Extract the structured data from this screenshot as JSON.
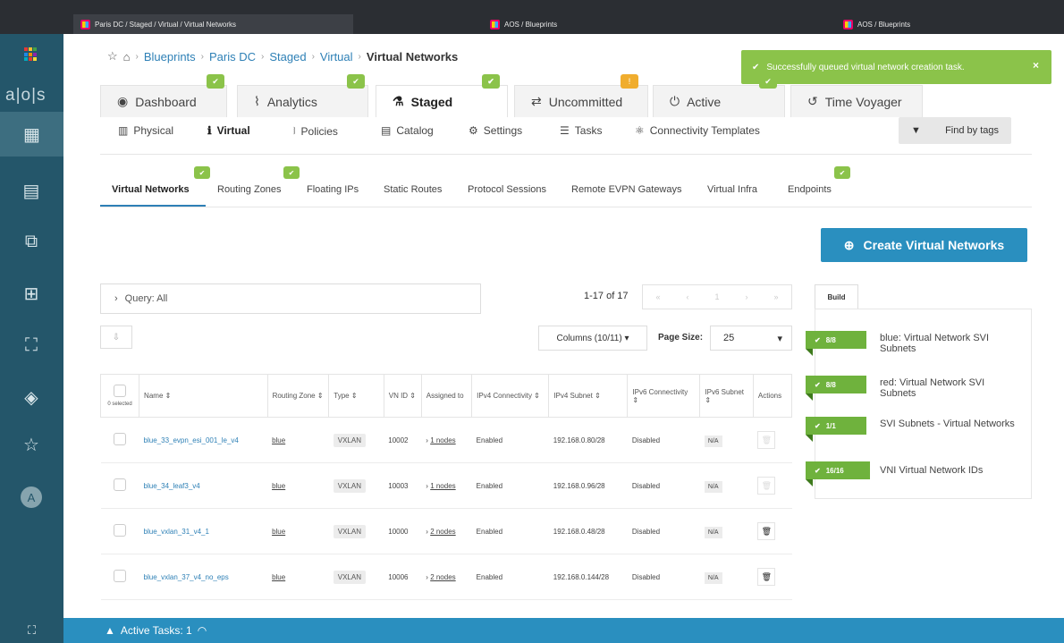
{
  "browser": {
    "tabs": [
      {
        "title": "Paris DC / Staged / Virtual / Virtual Networks"
      },
      {
        "title": "AOS / Blueprints"
      },
      {
        "title": "AOS / Blueprints"
      }
    ]
  },
  "rail": {
    "logo_text": "a|o|s",
    "logo_colors": [
      "#e53935",
      "#fbc02d",
      "#43a047",
      "#1e88e5",
      "#fb8c00",
      "#8e24aa",
      "#00acc1",
      "#e53935",
      "#fdd835"
    ],
    "icons": [
      "blueprints-icon",
      "devices-icon",
      "design-icon",
      "resources-icon",
      "external-systems-icon",
      "platform-icon",
      "favorites-icon"
    ],
    "avatar": "A"
  },
  "breadcrumb": {
    "items": [
      "Blueprints",
      "Paris DC",
      "Staged",
      "Virtual"
    ],
    "current": "Virtual Networks"
  },
  "toast": {
    "message": "Successfully queued virtual network creation task.",
    "close": "×",
    "color": "#8bc34a"
  },
  "main_tabs": [
    {
      "label": "Dashboard",
      "icon": "◉",
      "badge": "✔"
    },
    {
      "label": "Analytics",
      "icon": "⌇",
      "badge": "✔"
    },
    {
      "label": "Staged",
      "icon": "⚗",
      "badge": "✔"
    },
    {
      "label": "Uncommitted",
      "icon": "⇄",
      "badge": "!"
    },
    {
      "label": "Active",
      "icon": "⏻",
      "badge": "✔"
    },
    {
      "label": "Time Voyager",
      "icon": "↺"
    }
  ],
  "sub_nav": [
    {
      "label": "Physical",
      "icon": "▥"
    },
    {
      "label": "Virtual",
      "icon": "ℹ"
    },
    {
      "label": "Policies",
      "icon": "⧘"
    },
    {
      "label": "Catalog",
      "icon": "▤"
    },
    {
      "label": "Settings",
      "icon": "⚙"
    },
    {
      "label": "Tasks",
      "icon": "☰"
    },
    {
      "label": "Connectivity Templates",
      "icon": "⚛"
    }
  ],
  "find_by_tags": "Find by tags",
  "virtual_tabs": [
    "Virtual Networks",
    "Routing Zones",
    "Floating IPs",
    "Static Routes",
    "Protocol Sessions",
    "Remote EVPN Gateways",
    "Virtual Infra",
    "Endpoints"
  ],
  "create_button": "Create Virtual Networks",
  "query": "Query: All",
  "pagination": {
    "range": "1-17 of 17",
    "buttons": [
      "«",
      "‹",
      "1",
      "›",
      "»"
    ]
  },
  "columns_button": "Columns (10/11)",
  "page_size": {
    "label": "Page Size:",
    "value": "25"
  },
  "table": {
    "selected": "0 selected",
    "headers": [
      "Name ⇕",
      "Routing Zone ⇕",
      "Type ⇕",
      "VN ID ⇕",
      "Assigned to",
      "IPv4 Connectivity ⇕",
      "IPv4 Subnet ⇕",
      "IPv6 Connectivity ⇕",
      "IPv6 Subnet ⇕",
      "Actions"
    ],
    "rows": [
      {
        "name": "blue_33_evpn_esi_001_le_v4",
        "zone": "blue",
        "type": "VXLAN",
        "vnid": "10002",
        "assigned": "1 nodes",
        "ipv4": "Enabled",
        "subnet4": "192.168.0.80/28",
        "ipv6": "Disabled",
        "subnet6": "N/A"
      },
      {
        "name": "blue_34_leaf3_v4",
        "zone": "blue",
        "type": "VXLAN",
        "vnid": "10003",
        "assigned": "1 nodes",
        "ipv4": "Enabled",
        "subnet4": "192.168.0.96/28",
        "ipv6": "Disabled",
        "subnet6": "N/A"
      },
      {
        "name": "blue_vxlan_31_v4_1",
        "zone": "blue",
        "type": "VXLAN",
        "vnid": "10000",
        "assigned": "2 nodes",
        "ipv4": "Enabled",
        "subnet4": "192.168.0.48/28",
        "ipv6": "Disabled",
        "subnet6": "N/A"
      },
      {
        "name": "blue_vxlan_37_v4_no_eps",
        "zone": "blue",
        "type": "VXLAN",
        "vnid": "10006",
        "assigned": "2 nodes",
        "ipv4": "Enabled",
        "subnet4": "192.168.0.144/28",
        "ipv6": "Disabled",
        "subnet6": "N/A"
      }
    ]
  },
  "build": {
    "tab": "Build",
    "items": [
      {
        "count": "8/8",
        "text": "blue: Virtual Network SVI Subnets"
      },
      {
        "count": "8/8",
        "text": "red: Virtual Network SVI Subnets"
      },
      {
        "count": "1/1",
        "text": "SVI Subnets - Virtual Networks"
      },
      {
        "count": "16/16",
        "text": "VNI Virtual Network IDs"
      }
    ]
  },
  "active_tasks": "Active Tasks: 1"
}
